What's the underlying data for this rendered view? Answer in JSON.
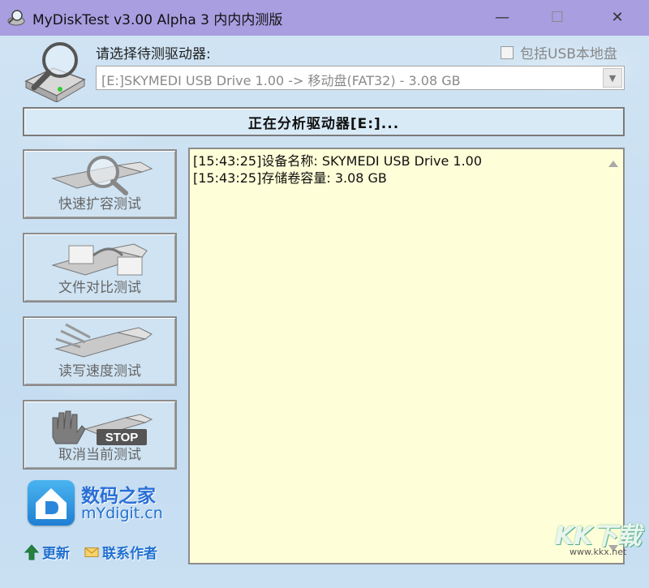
{
  "window": {
    "title": "MyDiskTest v3.00 Alpha 3 内内内测版",
    "controls": {
      "minimize": "—",
      "maximize": "☐",
      "close": "✕"
    }
  },
  "drive_select": {
    "label": "请选择待测驱动器:",
    "value": "[E:]SKYMEDI USB Drive 1.00 -> 移动盘(FAT32) - 3.08 GB",
    "include_usb_label": "包括USB本地盘",
    "include_usb_checked": false
  },
  "status": {
    "text": "正在分析驱动器[E:]..."
  },
  "buttons": {
    "quick": "快速扩容测试",
    "compare": "文件对比测试",
    "speed": "读写速度测试",
    "stop": "取消当前测试",
    "stop_sign": "STOP"
  },
  "brand": {
    "name": "数码之家",
    "url": "mYdigit.cn"
  },
  "links": {
    "update": "更新",
    "contact": "联系作者"
  },
  "log": {
    "lines": [
      "[15:43:25]设备名称: SKYMEDI USB Drive 1.00",
      "[15:43:25]存储卷容量: 3.08 GB"
    ]
  },
  "watermark": {
    "main": "KK下载",
    "url": "www.kkx.net"
  },
  "colors": {
    "titlebar": "#a89ee0",
    "client": "#cfe3f3",
    "log_bg": "#fefed8",
    "link": "#1f6fd0"
  }
}
